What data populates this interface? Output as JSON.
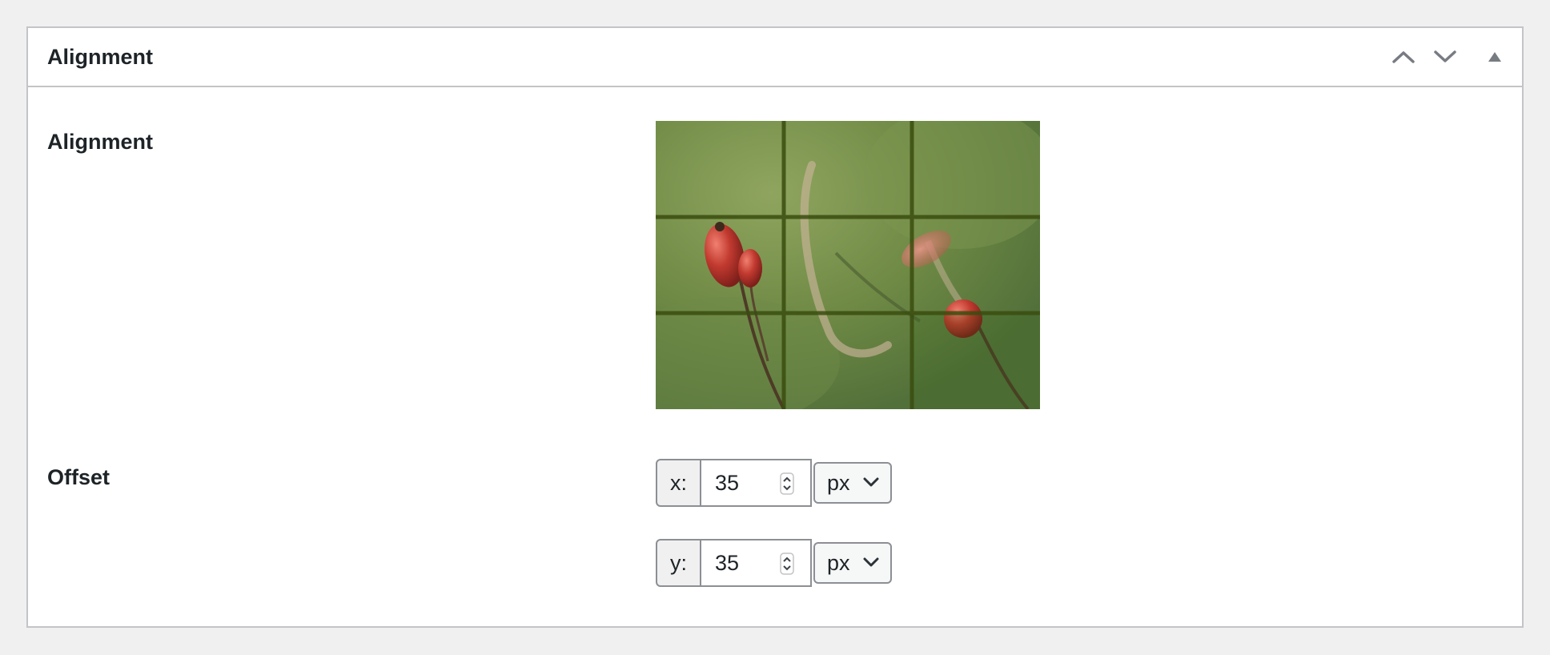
{
  "panel": {
    "title": "Alignment",
    "controls": [
      "move-up",
      "move-down",
      "toggle-panel"
    ]
  },
  "fields": {
    "alignment": {
      "label": "Alignment"
    },
    "offset": {
      "label": "Offset",
      "x": {
        "axis_label": "x:",
        "value": "35",
        "unit": "px"
      },
      "y": {
        "axis_label": "y:",
        "value": "35",
        "unit": "px"
      }
    }
  },
  "colors": {
    "border": "#c3c4c7",
    "page_bg": "#f0f0f1",
    "grid_line": "#3a4d0f",
    "selected_cell_tint": "#6b8f3a"
  }
}
